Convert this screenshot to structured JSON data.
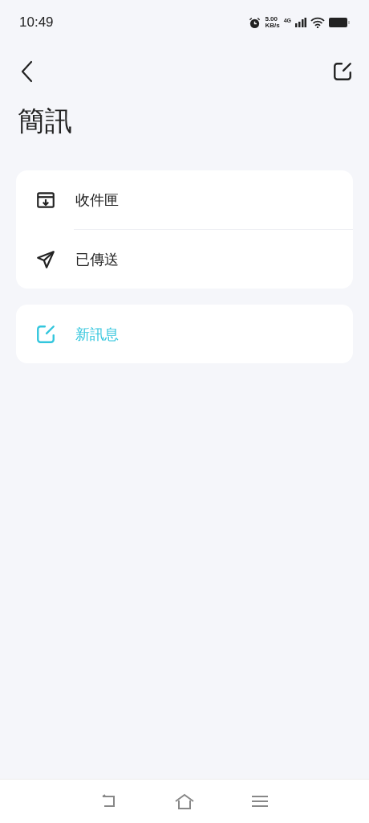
{
  "status_bar": {
    "time": "10:49",
    "speed_value": "5.00",
    "speed_unit": "KB/s",
    "network": "4G"
  },
  "title": "簡訊",
  "folders": [
    {
      "kind": "inbox",
      "label": "收件匣"
    },
    {
      "kind": "sent",
      "label": "已傳送"
    }
  ],
  "compose": {
    "label": "新訊息"
  }
}
